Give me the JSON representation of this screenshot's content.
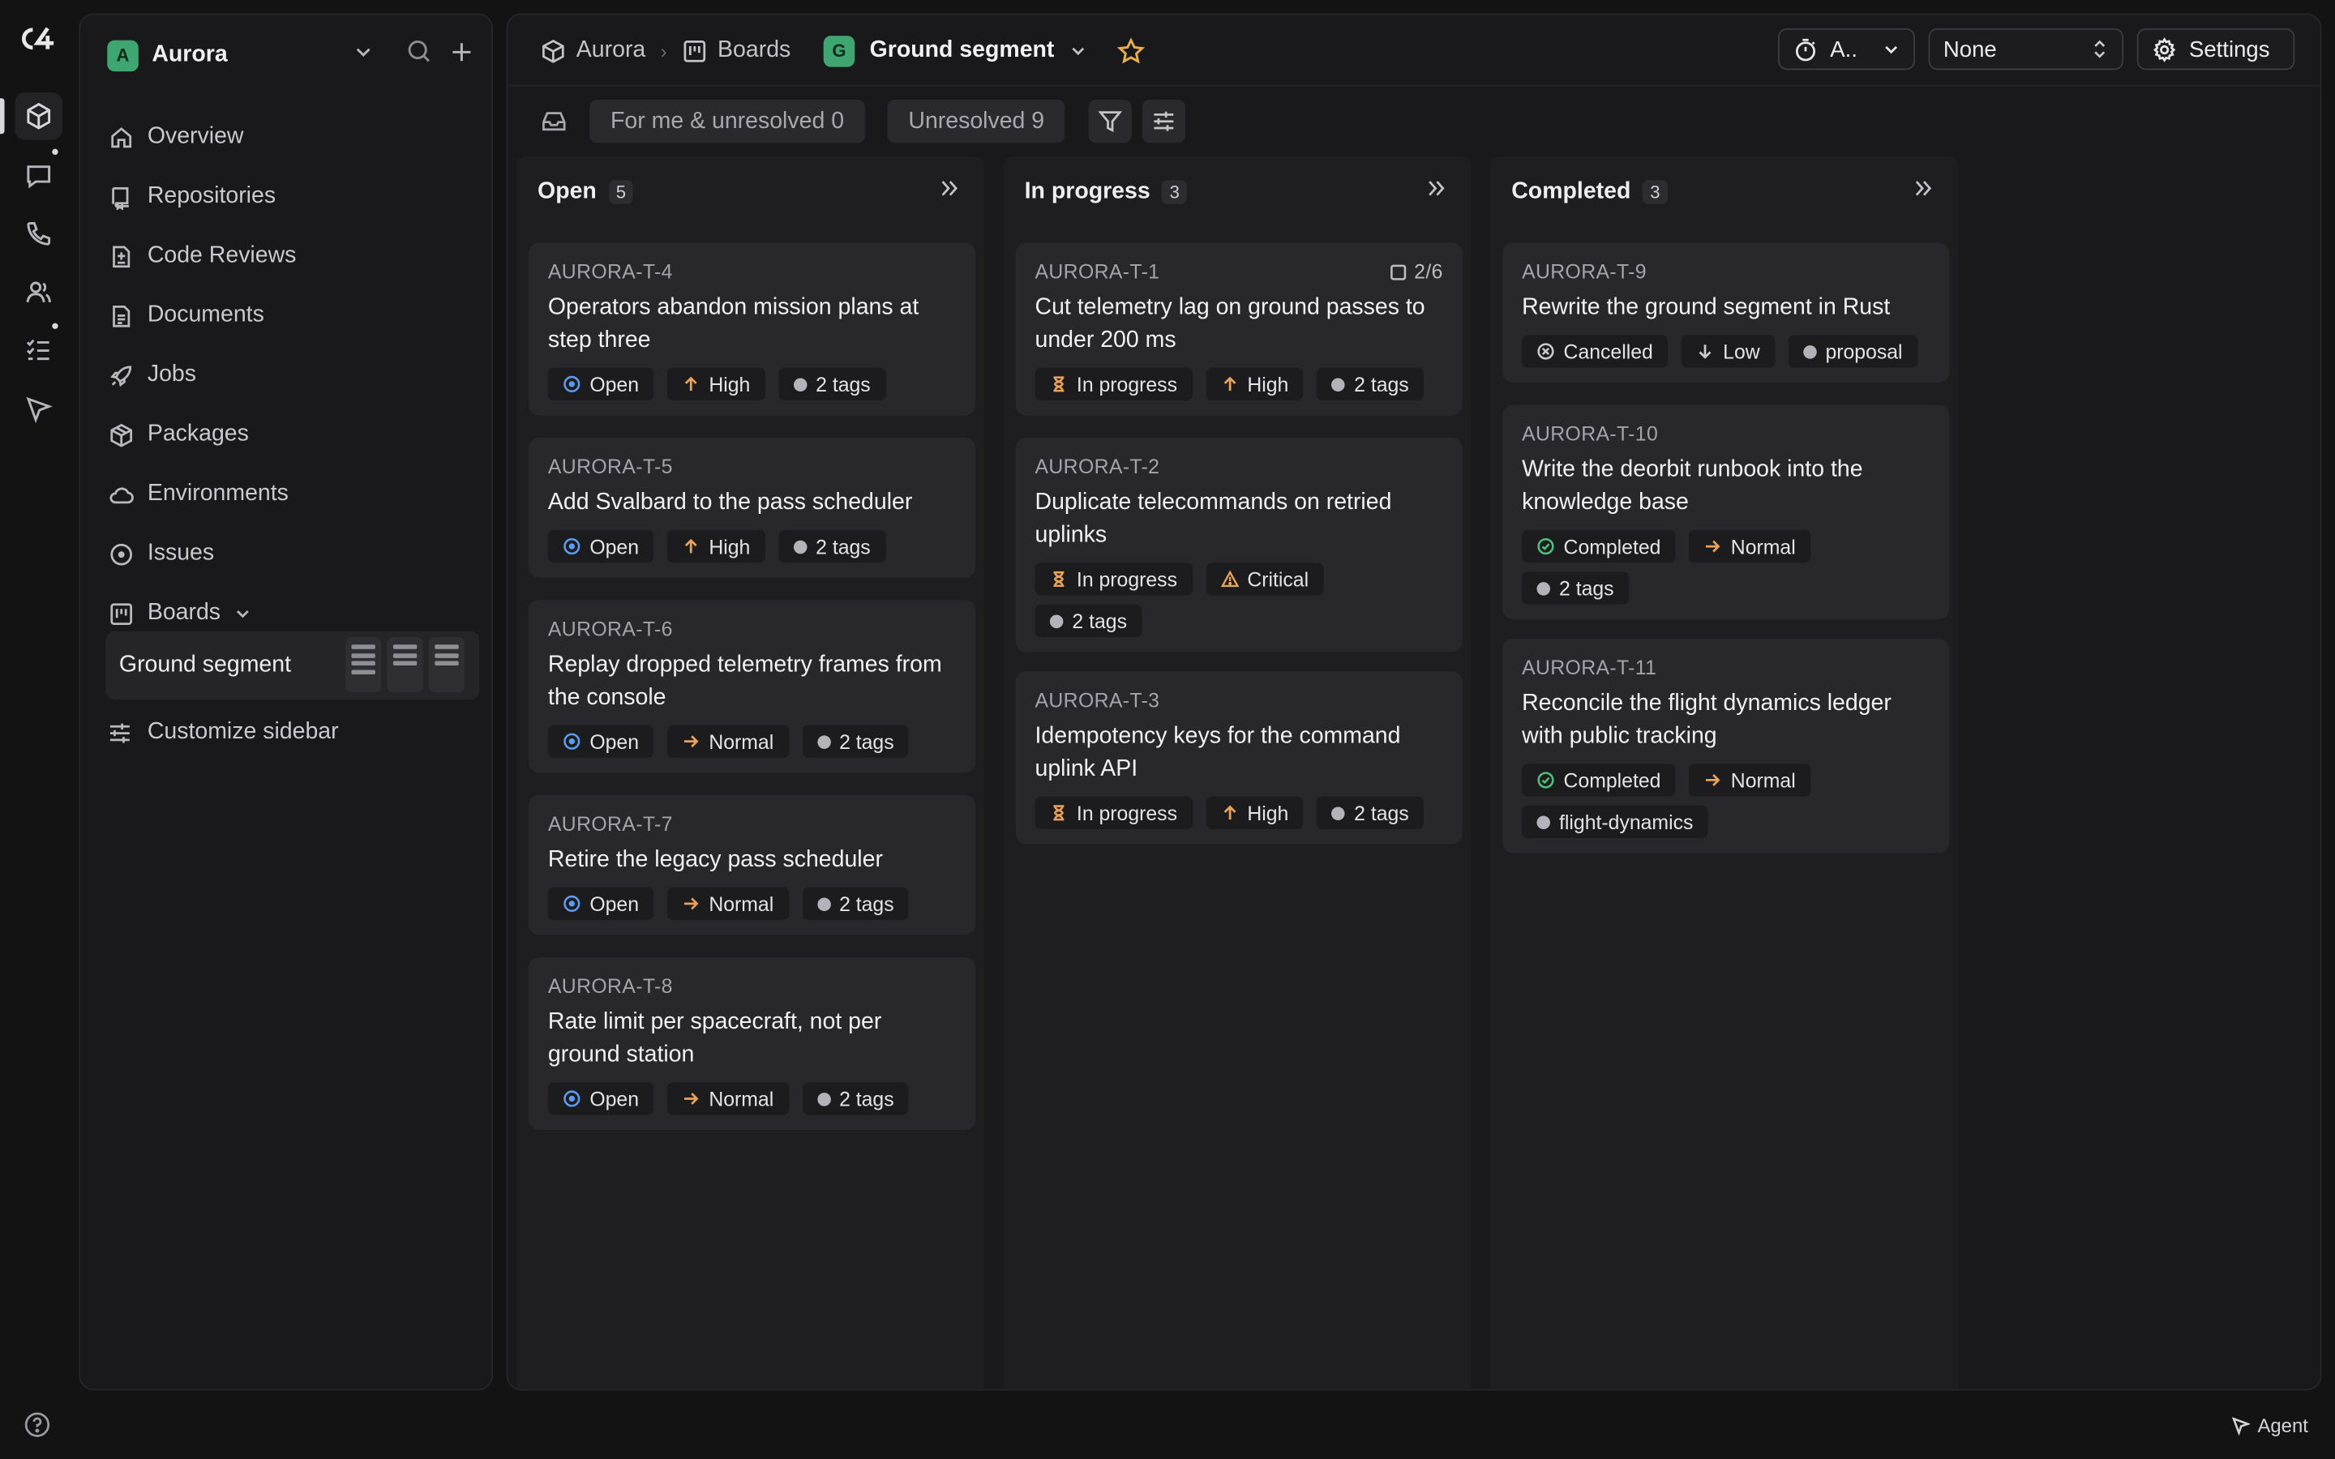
{
  "sidebar": {
    "workspace": {
      "initial": "A",
      "name": "Aurora"
    },
    "items": [
      {
        "label": "Overview",
        "icon": "home-icon"
      },
      {
        "label": "Repositories",
        "icon": "repo-icon"
      },
      {
        "label": "Code Reviews",
        "icon": "code-review-icon"
      },
      {
        "label": "Documents",
        "icon": "document-icon"
      },
      {
        "label": "Jobs",
        "icon": "rocket-icon"
      },
      {
        "label": "Packages",
        "icon": "package-icon"
      },
      {
        "label": "Environments",
        "icon": "cloud-icon"
      },
      {
        "label": "Issues",
        "icon": "issue-icon"
      },
      {
        "label": "Boards",
        "icon": "board-icon"
      }
    ],
    "active_board": "Ground segment",
    "customize": "Customize sidebar"
  },
  "breadcrumb": {
    "project": "Aurora",
    "section": "Boards",
    "board_initial": "G",
    "board": "Ground segment"
  },
  "toolbar": {
    "timer_label": "A..",
    "select_value": "None",
    "settings_label": "Settings"
  },
  "filters": {
    "for_me": "For me & unresolved 0",
    "unresolved": "Unresolved 9"
  },
  "columns": [
    {
      "title": "Open",
      "count": "5",
      "cards": [
        {
          "id": "AURORA-T-4",
          "title": "Operators abandon mission plans at step three",
          "status": "Open",
          "priority": "High",
          "tags": "2 tags"
        },
        {
          "id": "AURORA-T-5",
          "title": "Add Svalbard to the pass scheduler",
          "status": "Open",
          "priority": "High",
          "tags": "2 tags"
        },
        {
          "id": "AURORA-T-6",
          "title": "Replay dropped telemetry frames from the console",
          "status": "Open",
          "priority": "Normal",
          "tags": "2 tags"
        },
        {
          "id": "AURORA-T-7",
          "title": "Retire the legacy pass scheduler",
          "status": "Open",
          "priority": "Normal",
          "tags": "2 tags"
        },
        {
          "id": "AURORA-T-8",
          "title": "Rate limit per spacecraft, not per ground station",
          "status": "Open",
          "priority": "Normal",
          "tags": "2 tags"
        }
      ]
    },
    {
      "title": "In progress",
      "count": "3",
      "cards": [
        {
          "id": "AURORA-T-1",
          "subtasks": "2/6",
          "title": "Cut telemetry lag on ground passes to under 200 ms",
          "status": "In progress",
          "priority": "High",
          "tags": "2 tags"
        },
        {
          "id": "AURORA-T-2",
          "title": "Duplicate telecommands on retried uplinks",
          "status": "In progress",
          "priority": "Critical",
          "tags": "2 tags"
        },
        {
          "id": "AURORA-T-3",
          "title": "Idempotency keys for the command uplink API",
          "status": "In progress",
          "priority": "High",
          "tags": "2 tags"
        }
      ]
    },
    {
      "title": "Completed",
      "count": "3",
      "cards": [
        {
          "id": "AURORA-T-9",
          "title": "Rewrite the ground segment in Rust",
          "status": "Cancelled",
          "priority": "Low",
          "tags": "proposal"
        },
        {
          "id": "AURORA-T-10",
          "title": "Write the deorbit runbook into the knowledge base",
          "status": "Completed",
          "priority": "Normal",
          "tags": "2 tags"
        },
        {
          "id": "AURORA-T-11",
          "title": "Reconcile the flight dynamics ledger with public tracking",
          "status": "Completed",
          "priority": "Normal",
          "tags": "flight-dynamics"
        }
      ]
    }
  ],
  "agent_label": "Agent",
  "colors": {
    "accent_green": "#3fa672",
    "open_blue": "#5b9cf0",
    "priority_orange": "#e8a25a",
    "completed_green": "#4fbf7d"
  }
}
